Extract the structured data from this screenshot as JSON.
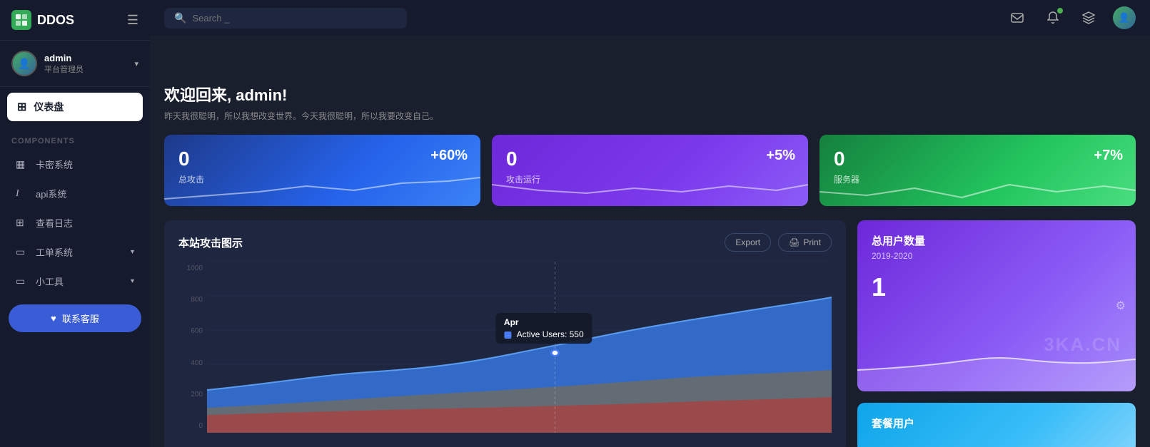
{
  "logo": {
    "text": "DDOS",
    "icon_label": "D"
  },
  "sidebar": {
    "user": {
      "name": "admin",
      "role": "平台管理员"
    },
    "nav_dashboard": "仪表盘",
    "components_label": "COMPONENTS",
    "items": [
      {
        "id": "card-system",
        "label": "卡密系统",
        "icon": "▦"
      },
      {
        "id": "api-system",
        "label": "api系统",
        "icon": "Ⅰ"
      },
      {
        "id": "view-logs",
        "label": "查看日志",
        "icon": "▦"
      },
      {
        "id": "ticket-system",
        "label": "工单系统",
        "icon": "▭",
        "has_arrow": true
      },
      {
        "id": "tools",
        "label": "小工具",
        "icon": "▭",
        "has_arrow": true
      }
    ],
    "contact_btn": "联系客服"
  },
  "topbar": {
    "search_placeholder": "Search _",
    "icons": [
      "mail",
      "bell",
      "layers",
      "user-avatar"
    ]
  },
  "welcome": {
    "title": "欢迎回来, admin!",
    "subtitle": "昨天我很聪明，所以我想改变世界。今天我很聪明，所以我要改变自己。"
  },
  "stat_cards": [
    {
      "id": "total-attack",
      "label": "总攻击",
      "value": "0",
      "percent": "+60%",
      "theme": "blue"
    },
    {
      "id": "running-attack",
      "label": "攻击运行",
      "value": "0",
      "percent": "+5%",
      "theme": "purple"
    },
    {
      "id": "servers",
      "label": "服务器",
      "value": "0",
      "percent": "+7%",
      "theme": "green"
    }
  ],
  "attack_chart": {
    "title": "本站攻击图示",
    "export_label": "Export",
    "print_label": "Print",
    "y_labels": [
      "1000",
      "800",
      "600",
      "400",
      "200",
      "0"
    ],
    "tooltip": {
      "month": "Apr",
      "label": "Active Users",
      "value": "550"
    }
  },
  "user_count_panel": {
    "title": "总用户数量",
    "subtitle": "2019-2020",
    "value": "1",
    "watermark": "3KA.CN"
  },
  "package_panel": {
    "title": "套餐用户"
  }
}
